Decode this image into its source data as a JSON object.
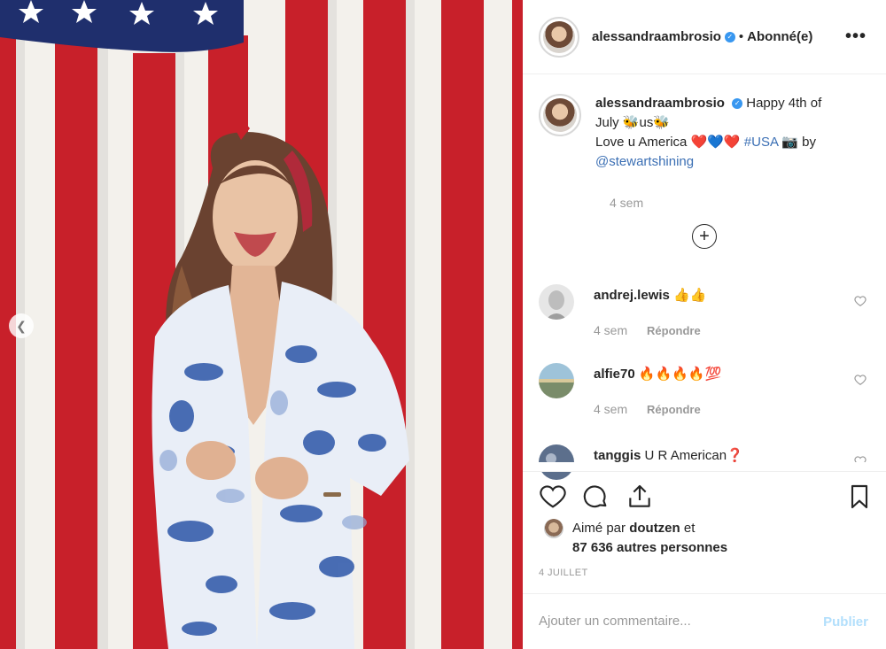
{
  "post": {
    "username": "alessandraambrosio",
    "follow_status": "Abonné(e)",
    "more_label": "•••"
  },
  "caption": {
    "username": "alessandraambrosio",
    "text_line1": "Happy 4th of",
    "text_line2": "July 🐝us🐝",
    "text_line3": "Love u America ❤️💙❤️",
    "hashtag": "#USA",
    "camera_emoji": "📷",
    "by": "by",
    "mention": "@stewartshining",
    "time": "4 sem"
  },
  "load_more_label": "+",
  "comments": [
    {
      "username": "andrej.lewis",
      "text": "👍👍",
      "time": "4 sem",
      "reply": "Répondre"
    },
    {
      "username": "alfie70",
      "text": "🔥🔥🔥🔥💯",
      "time": "4 sem",
      "reply": "Répondre"
    },
    {
      "username": "tanggis",
      "text": "U R American❓",
      "time": "",
      "reply": ""
    }
  ],
  "likes": {
    "prefix": "Aimé par",
    "user": "doutzen",
    "suffix": "et",
    "count_text": "87 636 autres personnes"
  },
  "date": "4 JUILLET",
  "add_comment": {
    "placeholder": "Ajouter un commentaire...",
    "publish": "Publier"
  },
  "icons": {
    "carousel_prev": "chevron-left-icon",
    "like": "heart-icon",
    "comment": "comment-icon",
    "share": "share-icon",
    "save": "bookmark-icon",
    "more": "more-icon"
  },
  "colors": {
    "flag_red": "#c8202a",
    "flag_blue": "#1f2f6d",
    "link_blue": "#3b6fb4",
    "verified_blue": "#3897f0",
    "publish_disabled": "#b2dffc"
  }
}
